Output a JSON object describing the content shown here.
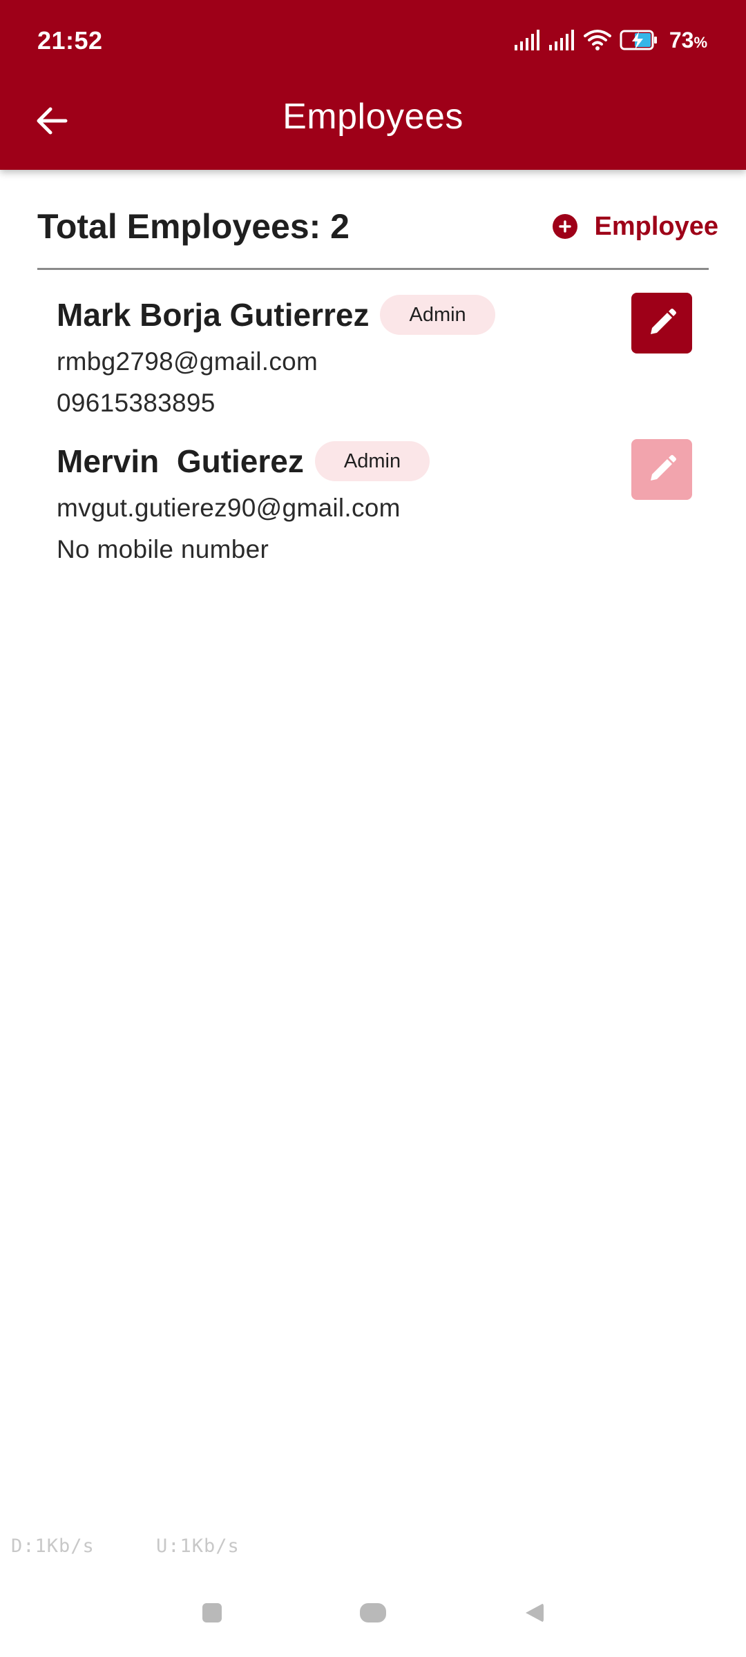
{
  "status_bar": {
    "time": "21:52",
    "battery_percent": "73",
    "battery_unit": "%",
    "icons": [
      "signal-icon",
      "signal-icon",
      "wifi-icon",
      "battery-charging-icon"
    ]
  },
  "app_bar": {
    "title": "Employees",
    "back_icon": "arrow-left-icon"
  },
  "summary": {
    "total_label": "Total Employees: 2",
    "add_label": "Employee",
    "add_icon": "plus-circle-icon"
  },
  "employees": [
    {
      "name": "Mark Borja Gutierrez",
      "role": "Admin",
      "email": "rmbg2798@gmail.com",
      "phone": "09615383895",
      "edit_enabled": true
    },
    {
      "name": "Mervin  Gutierez",
      "role": "Admin",
      "email": "mvgut.gutierez90@gmail.com",
      "phone": "No mobile number",
      "edit_enabled": false
    }
  ],
  "net_speed": {
    "download": "D:1Kb/s",
    "upload": "U:1Kb/s"
  },
  "colors": {
    "primary": "#9e0018",
    "badge_bg": "#fbe6e8",
    "edit_disabled": "#f2a4ad"
  }
}
